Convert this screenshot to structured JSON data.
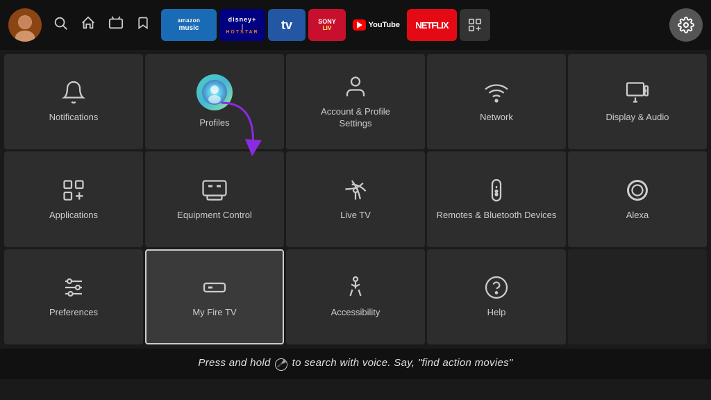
{
  "nav": {
    "avatar_emoji": "👨",
    "icons": [
      "🔍",
      "🏠",
      "📺",
      "🔖"
    ],
    "apps": [
      {
        "name": "amazon-music",
        "label": "amazon music",
        "type": "amazon-music"
      },
      {
        "name": "disney-hotstar",
        "label": "disney+ hotstar",
        "type": "disney"
      },
      {
        "name": "tata-play",
        "label": "tv",
        "type": "tata"
      },
      {
        "name": "sony-liv",
        "label": "SONY",
        "type": "sony"
      },
      {
        "name": "youtube",
        "label": "YouTube",
        "type": "youtube"
      },
      {
        "name": "netflix",
        "label": "NETFLIX",
        "type": "netflix"
      },
      {
        "name": "more-apps",
        "label": "⊞",
        "type": "grid"
      }
    ],
    "settings_icon": "⚙️"
  },
  "settings": {
    "tiles": [
      {
        "id": "notifications",
        "label": "Notifications",
        "icon": "bell"
      },
      {
        "id": "profiles",
        "label": "Profiles",
        "icon": "profile-avatar"
      },
      {
        "id": "account-profile",
        "label": "Account & Profile Settings",
        "icon": "person"
      },
      {
        "id": "network",
        "label": "Network",
        "icon": "wifi"
      },
      {
        "id": "display-audio",
        "label": "Display & Audio",
        "icon": "monitor-speaker"
      },
      {
        "id": "applications",
        "label": "Applications",
        "icon": "apps-grid"
      },
      {
        "id": "equipment-control",
        "label": "Equipment Control",
        "icon": "tv-display"
      },
      {
        "id": "live-tv",
        "label": "Live TV",
        "icon": "antenna"
      },
      {
        "id": "remotes-bluetooth",
        "label": "Remotes & Bluetooth Devices",
        "icon": "remote"
      },
      {
        "id": "alexa",
        "label": "Alexa",
        "icon": "alexa-ring"
      },
      {
        "id": "preferences",
        "label": "Preferences",
        "icon": "sliders"
      },
      {
        "id": "my-fire-tv",
        "label": "My Fire TV",
        "icon": "fire-tv-box"
      },
      {
        "id": "accessibility",
        "label": "Accessibility",
        "icon": "accessibility-person"
      },
      {
        "id": "help",
        "label": "Help",
        "icon": "help-circle"
      },
      {
        "id": "empty",
        "label": "",
        "icon": "none"
      }
    ]
  },
  "hint": {
    "text": "Press and hold 🎤 to search with voice. Say, \"find action movies\""
  }
}
